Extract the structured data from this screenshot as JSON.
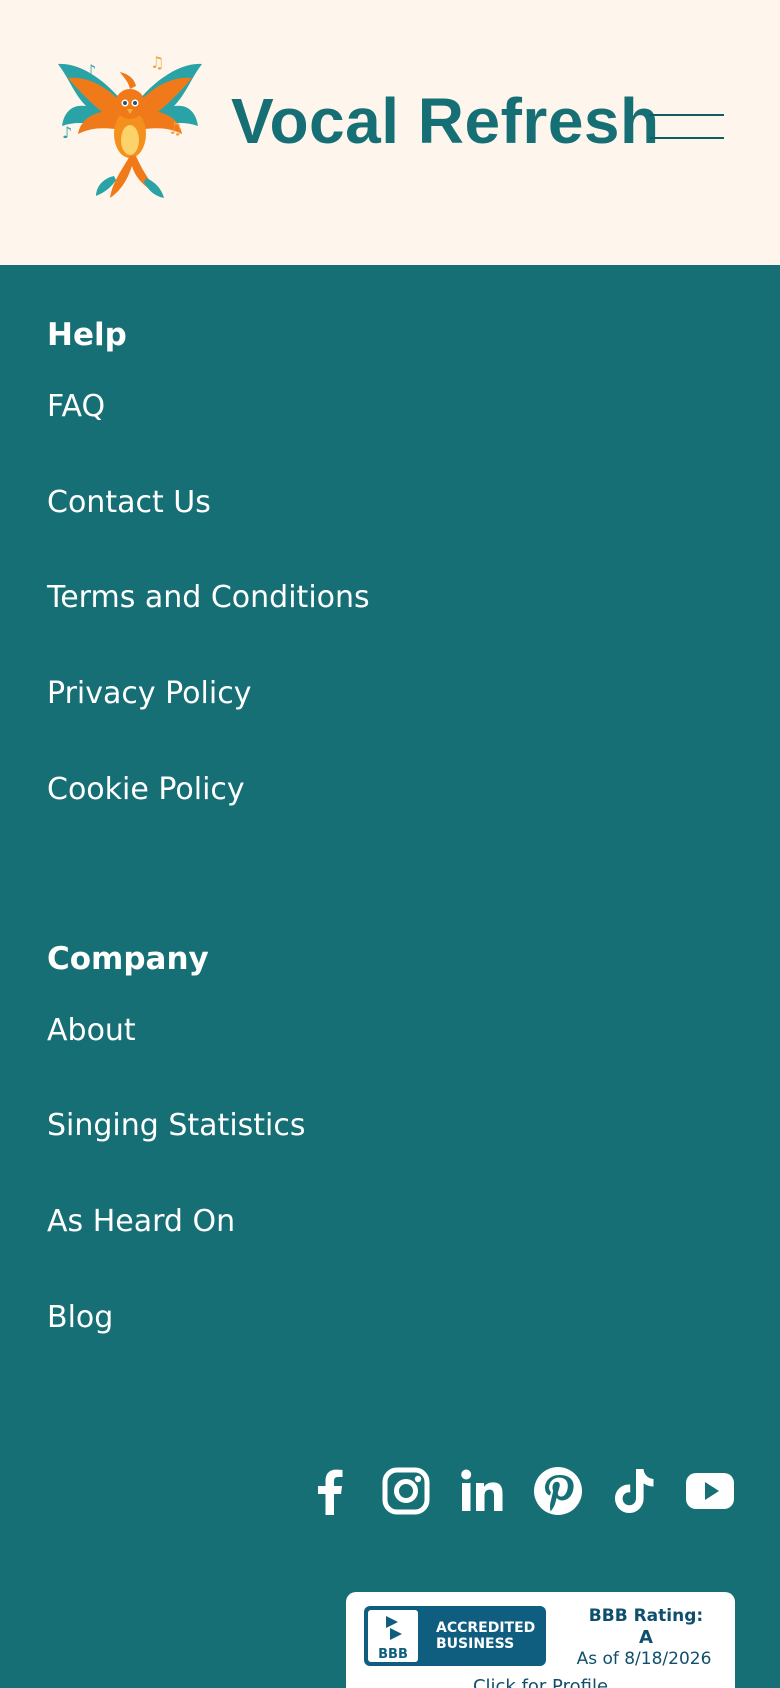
{
  "header": {
    "site_title": "Vocal Refresh",
    "logo_icon": "phoenix-logo-icon",
    "menu_icon": "hamburger-menu-icon"
  },
  "footer": {
    "help": {
      "title": "Help",
      "links": [
        "FAQ",
        "Contact Us",
        "Terms and Conditions",
        "Privacy Policy",
        "Cookie Policy"
      ]
    },
    "company": {
      "title": "Company",
      "links": [
        "About",
        "Singing Statistics",
        "As Heard On",
        "Blog"
      ]
    },
    "social_icons": [
      "facebook-icon",
      "instagram-icon",
      "linkedin-icon",
      "pinterest-icon",
      "tiktok-icon",
      "youtube-icon"
    ],
    "bbb": {
      "seal_line1": "ACCREDITED",
      "seal_line2": "BUSINESS",
      "seal_logo": "BBB",
      "rating_label": "BBB Rating:",
      "rating_value": "A",
      "rating_date": "As of 8/18/2026",
      "profile_link": "Click for Profile"
    }
  },
  "colors": {
    "header_bg": "#fef6ec",
    "footer_bg": "#166f75",
    "brand_teal": "#176f76",
    "logo_orange": "#f07a1a",
    "logo_teal": "#2aa3a6"
  }
}
